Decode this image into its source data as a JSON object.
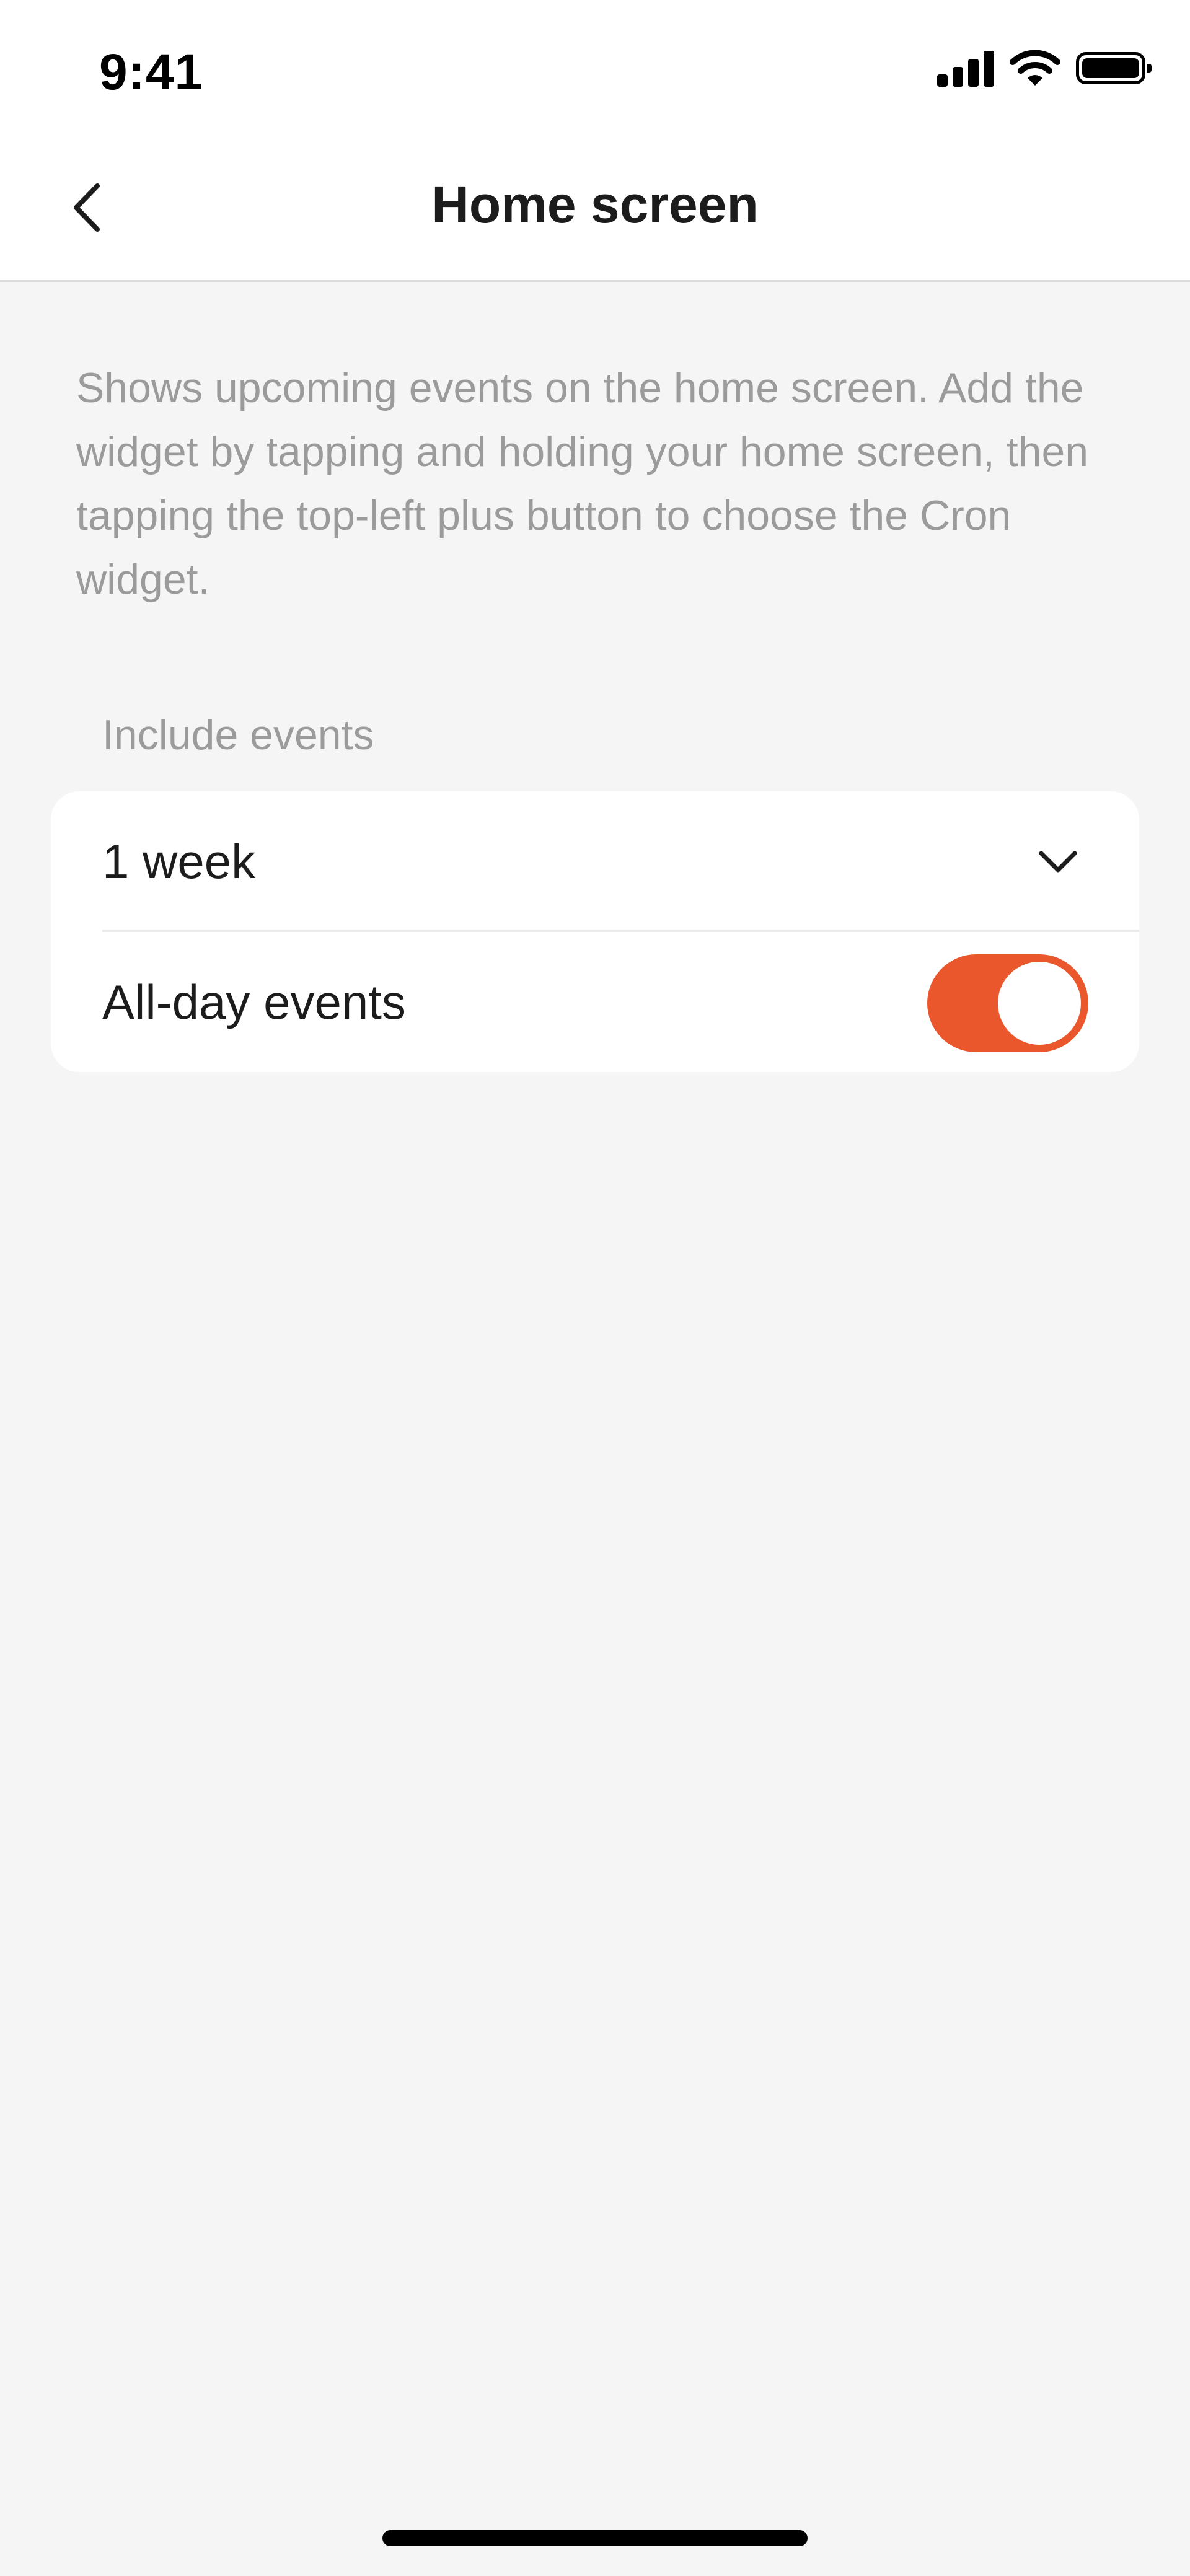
{
  "status_bar": {
    "time": "9:41",
    "icons": [
      "signal-icon",
      "wifi-icon",
      "battery-icon"
    ]
  },
  "nav": {
    "title": "Home screen",
    "back_icon": "chevron-left-icon"
  },
  "description": "Shows upcoming events on the home screen. Add the widget by tapping and holding your home screen, then tapping the top-left plus button to choose the Cron widget.",
  "section": {
    "label": "Include events",
    "range_value": "1 week",
    "range_icon": "chevron-down-icon",
    "all_day_label": "All-day events",
    "all_day_enabled": true
  },
  "colors": {
    "accent": "#ea572c",
    "background": "#f5f5f5",
    "card": "#ffffff",
    "secondary_text": "#9b9b9b",
    "primary_text": "#1c1c1c"
  }
}
